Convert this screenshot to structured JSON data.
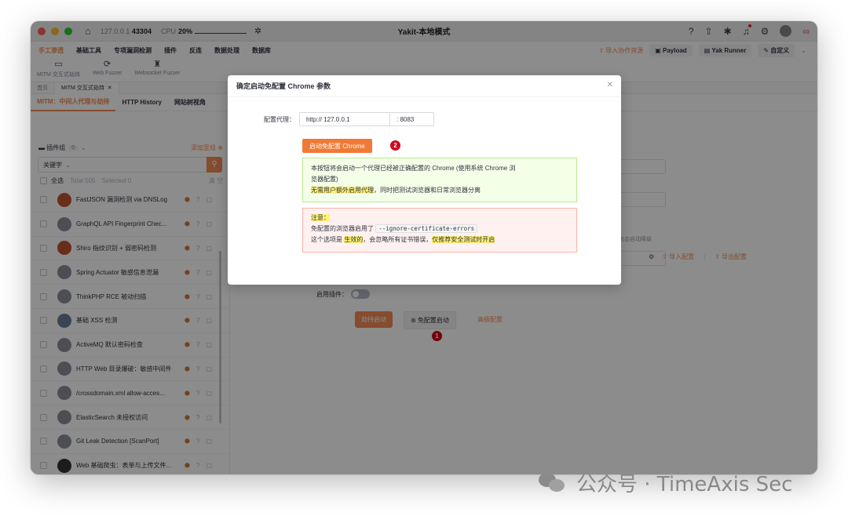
{
  "window": {
    "title": "Yakit-本地模式",
    "address_prefix": "127.0.0.1",
    "address_port": "43304",
    "cpu_label": "CPU",
    "cpu_value": "20%"
  },
  "menu": {
    "items": [
      "手工渗透",
      "基础工具",
      "专项漏洞检测",
      "插件",
      "反连",
      "数据处理",
      "数据库"
    ],
    "active_index": 0,
    "import_label": "导入协作资源",
    "payload_label": "Payload",
    "yak_runner_label": "Yak Runner",
    "custom_label": "自定义"
  },
  "tools": [
    "MITM 交互式劫持",
    "Web Fuzzer",
    "Websocket Fuzzer"
  ],
  "tabs": {
    "home": "首页",
    "mitm": "MITM 交互式劫持"
  },
  "subtabs": [
    "MITM：中间人代理与劫持",
    "HTTP History",
    "网站树视角"
  ],
  "sidebar": {
    "group_label": "插件组",
    "group_count": "0",
    "add_group": "添加至组",
    "keyword_label": "关键字",
    "select_all": "全选",
    "total": "Total 505",
    "selected": "Selected 0",
    "clear": "清 空",
    "plugins": [
      "FastJSON 漏洞检测 via DNSLog",
      "GraphQL API Fingerprint Chec...",
      "Shiro 指纹识别 + 弱密码检测",
      "Spring Actuator 敏感信息泄漏",
      "ThinkPHP RCE 被动扫描",
      "基础 XSS 检测",
      "ActiveMQ 默认密码检查",
      "HTTP Web 目录爆破：敏感中间件",
      "/crossdomain.xml allow-acces...",
      "ElasticSearch 未授权访问",
      "Git Leak Detection [ScanPort]",
      "Web 基础爬虫：表单与上传文件..."
    ]
  },
  "main": {
    "enable_plugins": "启用插件：",
    "start_hijack": "劫持启动",
    "free_config_start": "免配置启动",
    "advanced_config": "高级配置",
    "auto_degrade_hint": "也会自动降级",
    "import_config": "导入配置",
    "export_config": "导出配置",
    "badge1": "1"
  },
  "modal": {
    "title": "确定启动免配置 Chrome 参数",
    "proxy_label": "配置代理：",
    "proxy_host": "http:// 127.0.0.1",
    "proxy_port": ": 8083",
    "launch_button": "启动免配置 Chrome",
    "badge2": "2",
    "info_line1": "本按钮将会启动一个代理已经被正确配置的 Chrome (使用系统 Chrome 浏",
    "info_line2": "览器配置)",
    "info_hl": "无需用户额外启用代理",
    "info_rest": "，同时把测试浏览器和日常浏览器分离",
    "warn_title": "注意：",
    "warn_line1": "免配置的浏览器启用了",
    "warn_code": "--ignore-certificate-errors",
    "warn_line2_a": "这个选项是",
    "warn_line2_hl": "生效的",
    "warn_line2_b": "，会忽略所有证书错误，",
    "warn_line2_hl2": "仅推荐安全测试时开启"
  },
  "watermark": "公众号 · TimeAxis Sec"
}
